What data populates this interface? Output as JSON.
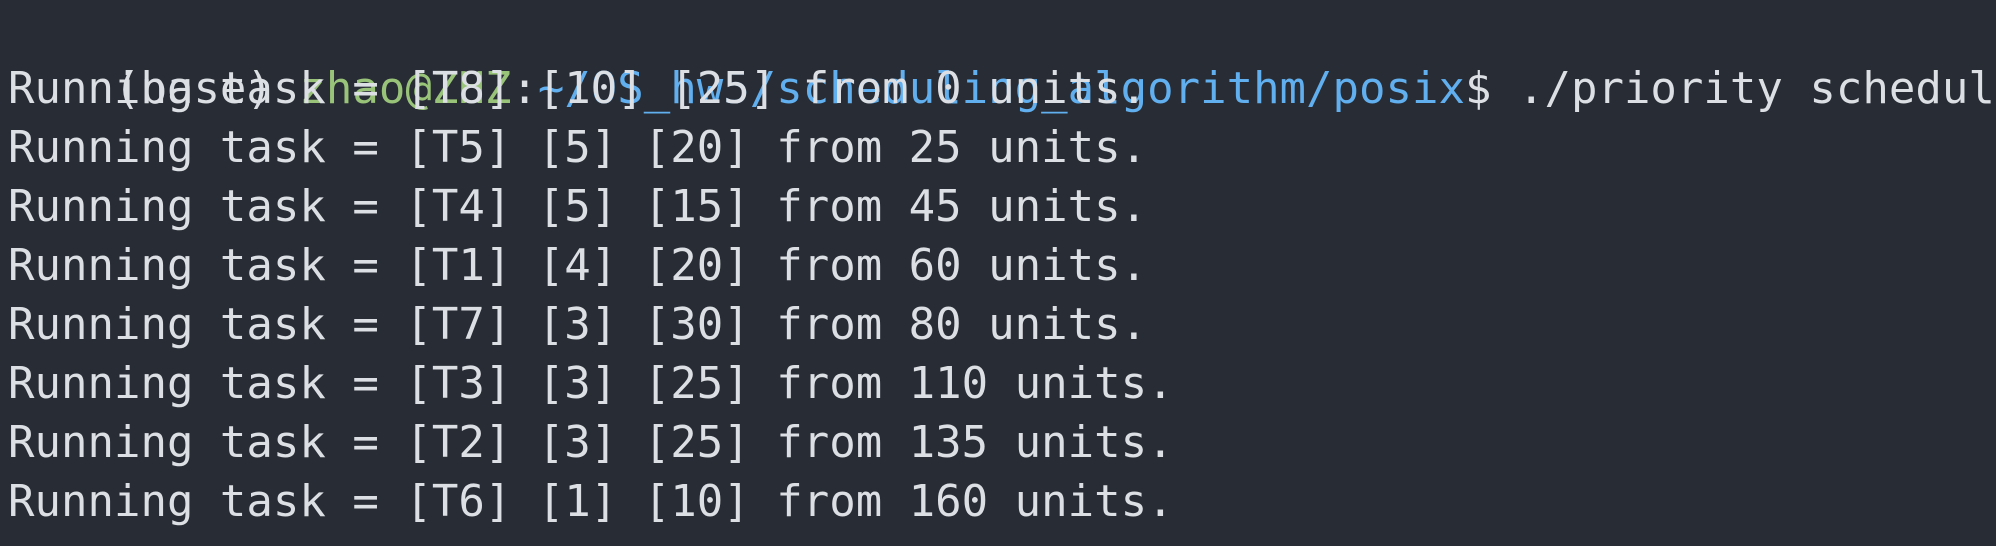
{
  "prompt": {
    "env": "(base) ",
    "user_host": "zhao@ZHZ",
    "sep": ":",
    "path": "~/OS_hw5/scheduling_algorithm/posix",
    "symbol": "$ ",
    "command": "./priority schedule.txt"
  },
  "output_lines": [
    "Running task = [T8] [10] [25] from 0 units.",
    "Running task = [T5] [5] [20] from 25 units.",
    "Running task = [T4] [5] [15] from 45 units.",
    "Running task = [T1] [4] [20] from 60 units.",
    "Running task = [T7] [3] [30] from 80 units.",
    "Running task = [T3] [3] [25] from 110 units.",
    "Running task = [T2] [3] [25] from 135 units.",
    "Running task = [T6] [1] [10] from 160 units."
  ],
  "colors": {
    "background": "#282c34",
    "text": "#dcdfe4",
    "user_host": "#98c379",
    "path": "#61afef"
  }
}
